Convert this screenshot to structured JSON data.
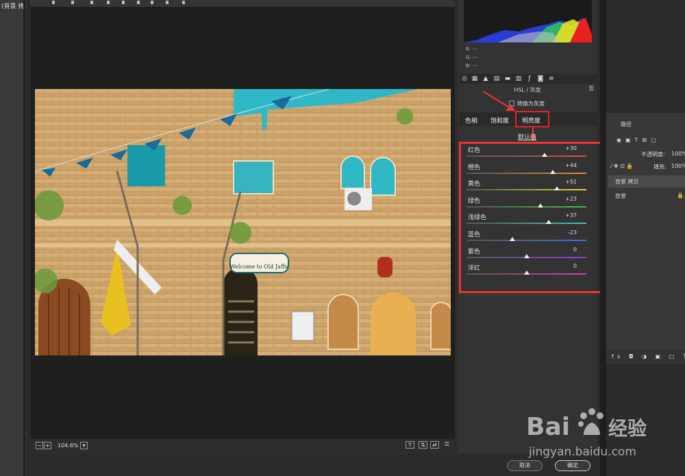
{
  "document": {
    "tab_title": "(背景 拷"
  },
  "histogram": {
    "r": "R:  ---",
    "g": "G:  ---",
    "b": "B:  ---"
  },
  "panel": {
    "section_title": "HSL / 灰度",
    "grayscale_label": "转换为灰度",
    "tabs": [
      "色相",
      "饱和度",
      "明亮度"
    ],
    "active_tab": "明亮度",
    "default_link": "默认值"
  },
  "sliders": [
    {
      "label": "红色",
      "value": 30,
      "display": "+30",
      "color": "#e84848"
    },
    {
      "label": "橙色",
      "value": 44,
      "display": "+44",
      "color": "#f08a30"
    },
    {
      "label": "黄色",
      "value": 51,
      "display": "+51",
      "color": "#e8d830"
    },
    {
      "label": "绿色",
      "value": 23,
      "display": "+23",
      "color": "#40c040"
    },
    {
      "label": "浅绿色",
      "value": 37,
      "display": "+37",
      "color": "#40c8c0"
    },
    {
      "label": "蓝色",
      "value": -23,
      "display": "-23",
      "color": "#4070e0"
    },
    {
      "label": "紫色",
      "value": 0,
      "display": "0",
      "color": "#9040d0"
    },
    {
      "label": "洋红",
      "value": 0,
      "display": "0",
      "color": "#d040b0"
    }
  ],
  "photo": {
    "sign_text": "Welcome to Old Jaffa"
  },
  "bottom": {
    "zoom": "104.6%",
    "cancel": "取消",
    "ok": "确定"
  },
  "layers": {
    "opacity_label": "不透明度:",
    "opacity_value": "100%",
    "fill_label": "填充:",
    "fill_value": "100%",
    "panel_tab": "路径",
    "layer_copy": "背景 拷贝",
    "layer_bg": "背景"
  },
  "watermark": {
    "brand": "Bai",
    "cn": "经验",
    "url": "jingyan.baidu.com"
  },
  "colors": {
    "accent_red": "#e33333",
    "panel_bg": "#333333",
    "sky": "#30b8c8"
  }
}
